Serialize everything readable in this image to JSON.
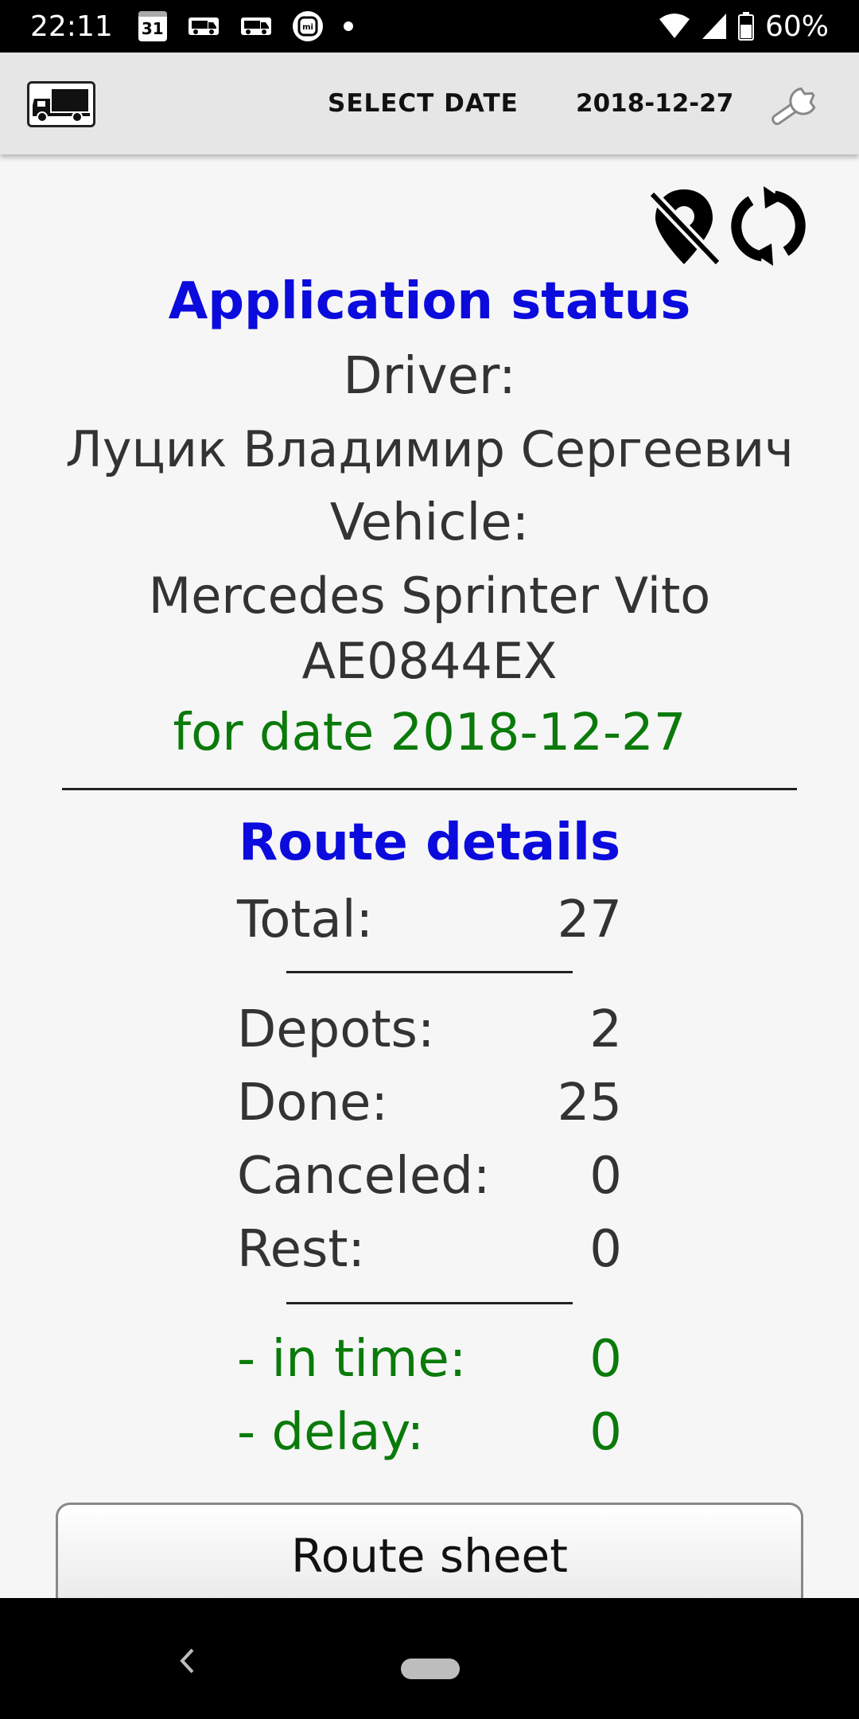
{
  "status_bar": {
    "time": "22:11",
    "calendar_day": "31",
    "battery": "60%"
  },
  "app_bar": {
    "select_date_label": "SELECT DATE",
    "date_value": "2018-12-27"
  },
  "application_status": {
    "title": "Application status",
    "driver_label": "Driver:",
    "driver_name": "Луцик Владимир Сергеевич",
    "vehicle_label": "Vehicle:",
    "vehicle_model": "Mercedes Sprinter Vito",
    "vehicle_plate": "AE0844EX",
    "for_date": "for date 2018-12-27"
  },
  "route_details": {
    "title": "Route details",
    "total": {
      "label": "Total:",
      "value": "27"
    },
    "depots": {
      "label": "Depots:",
      "value": "2"
    },
    "done": {
      "label": "Done:",
      "value": "25"
    },
    "canceled": {
      "label": "Canceled:",
      "value": "0"
    },
    "rest": {
      "label": "Rest:",
      "value": "0"
    },
    "in_time": {
      "label": "- in time:",
      "value": "0"
    },
    "delay": {
      "label": "- delay:",
      "value": "0"
    }
  },
  "buttons": {
    "route_sheet": "Route sheet"
  },
  "colors": {
    "title_blue": "#0b0bdd",
    "accent_green": "#0a7a0a",
    "text": "#333333",
    "app_bar": "#e6e6e6"
  }
}
